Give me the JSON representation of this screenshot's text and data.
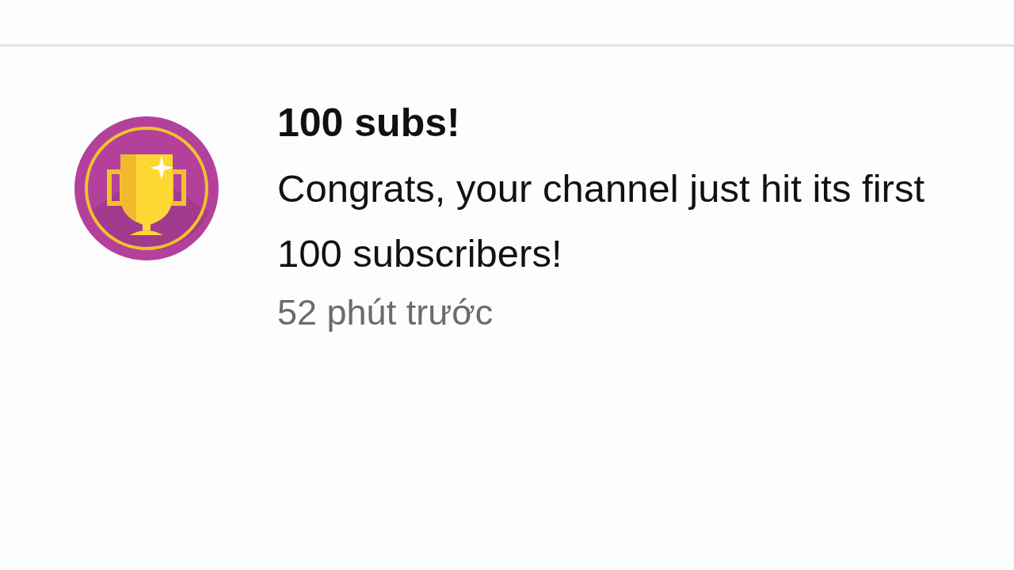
{
  "notification": {
    "title": "100 subs!",
    "message": "Congrats, your channel just hit its first 100 subscribers!",
    "time": "52 phút trước"
  }
}
